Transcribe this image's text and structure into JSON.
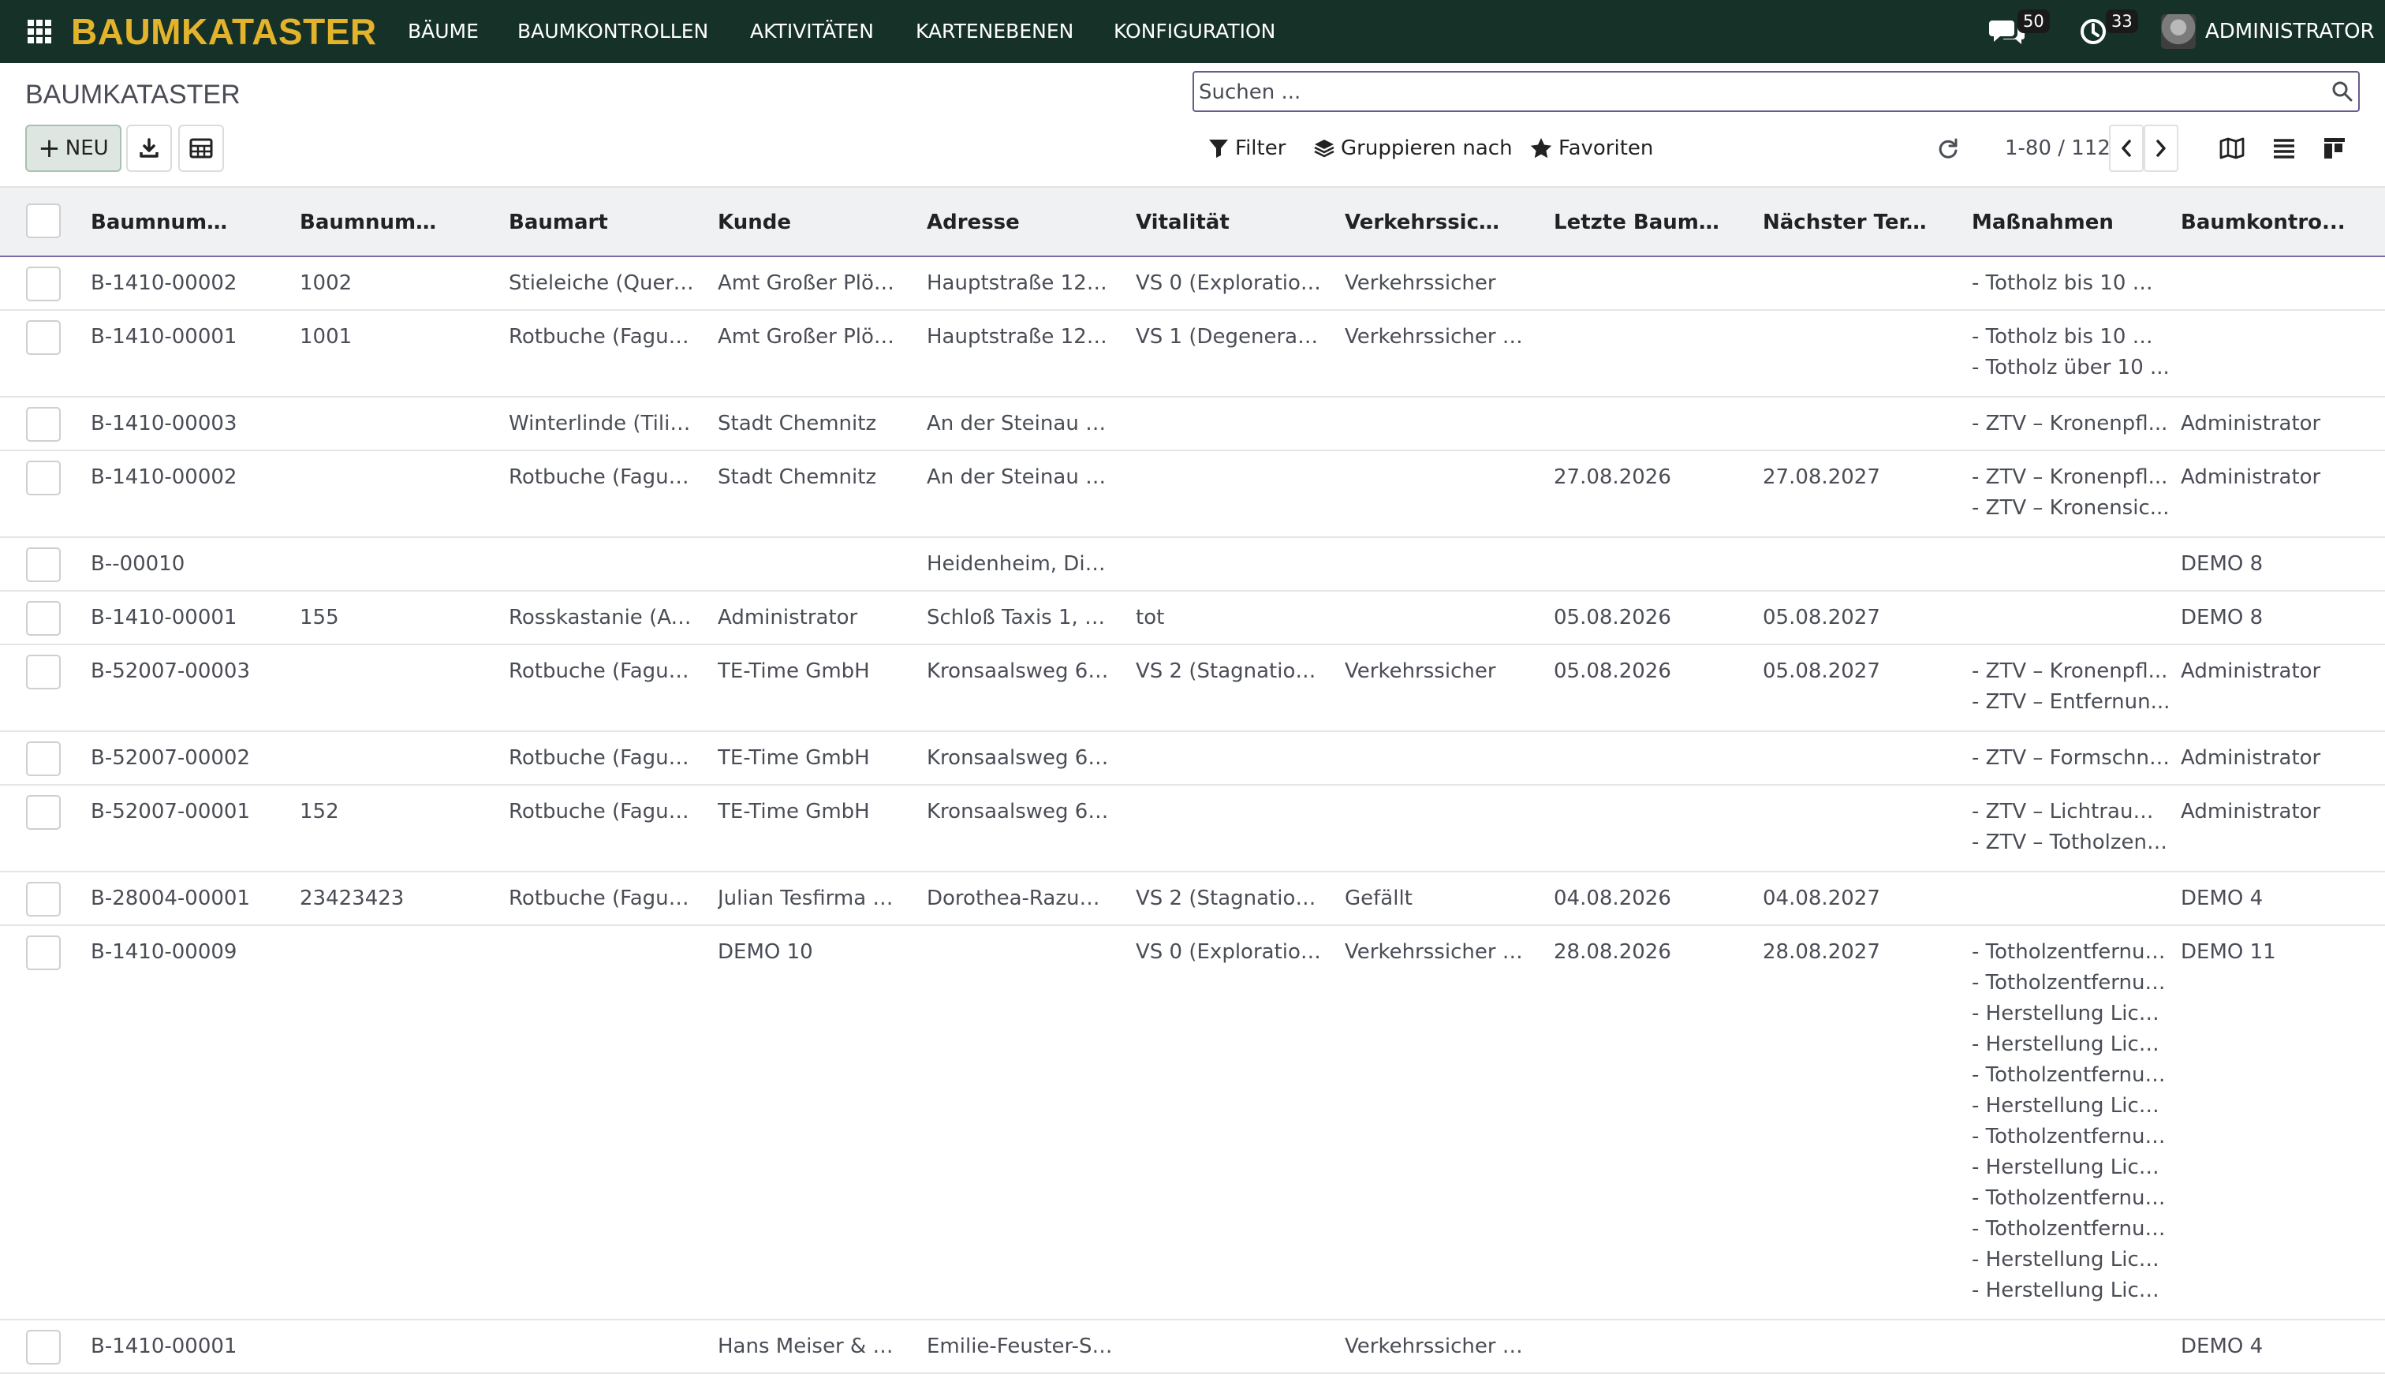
{
  "navbar": {
    "brand": "BAUMKATASTER",
    "menu": [
      "BÄUME",
      "BAUMKONTROLLEN",
      "AKTIVITÄTEN",
      "KARTENEBENEN",
      "KONFIGURATION"
    ],
    "messages_count": "50",
    "activities_count": "33",
    "user": "ADMINISTRATOR",
    "colors": {
      "background": "#163127",
      "brand": "#e4b32c"
    }
  },
  "control_panel": {
    "title": "BAUMKATASTER",
    "search_placeholder": "Suchen ...",
    "new_label": "NEU",
    "filter_label": "Filter",
    "group_label": "Gruppieren nach",
    "favorites_label": "Favoriten",
    "pager": "1-80 / 112"
  },
  "table": {
    "columns": [
      "Baumnummer...",
      "Baumnummer...",
      "Baumart",
      "Kunde",
      "Adresse",
      "Vitalität",
      "Verkehrssiche...",
      "Letzte Baumk...",
      "Nächster Ter...",
      "Maßnahmen",
      "Baumkontro..."
    ],
    "rows": [
      {
        "c": [
          "B-1410-00002",
          "1002",
          "Stieleiche (Quercu...",
          "Amt Großer Plöner...",
          "Hauptstraße 12, P...",
          "VS 0 (Explorations...",
          "Verkehrssicher",
          "",
          ""
        ],
        "m": [
          "- Totholz bis 10 m ..."
        ],
        "k": ""
      },
      {
        "c": [
          "B-1410-00001",
          "1001",
          "Rotbuche (Fagus s...",
          "Amt Großer Plöner...",
          "Hauptstraße 12, P...",
          "VS 1 (Degeneratio...",
          "Verkehrssicher na...",
          "",
          ""
        ],
        "m": [
          "- Totholz bis 10 m ...",
          "- Totholz über 10 ..."
        ],
        "k": ""
      },
      {
        "c": [
          "B-1410-00003",
          "",
          "Winterlinde (Tilia c...",
          "Stadt Chemnitz",
          "An der Steinau 34,...",
          "",
          "",
          "",
          ""
        ],
        "m": [
          "- ZTV – Kronenpfl..."
        ],
        "k": "Administrator"
      },
      {
        "c": [
          "B-1410-00002",
          "",
          "Rotbuche (Fagus s...",
          "Stadt Chemnitz",
          "An der Steinau 34,...",
          "",
          "",
          "27.08.2026",
          "27.08.2027"
        ],
        "m": [
          "- ZTV – Kronenpfl...",
          "- ZTV – Kronensic..."
        ],
        "k": "Administrator"
      },
      {
        "c": [
          "B--00010",
          "",
          "",
          "",
          "Heidenheim, Disch...",
          "",
          "",
          "",
          ""
        ],
        "m": [],
        "k": "DEMO 8"
      },
      {
        "c": [
          "B-1410-00001",
          "155",
          "Rosskastanie (Aes...",
          "Administrator",
          "Schloß Taxis 1, He...",
          "tot",
          "",
          "05.08.2026",
          "05.08.2027"
        ],
        "m": [],
        "k": "DEMO 8"
      },
      {
        "c": [
          "B-52007-00003",
          "",
          "Rotbuche (Fagus s...",
          "TE-Time GmbH",
          "Kronsaalsweg 66, ...",
          "VS 2 (Stagnations...",
          "Verkehrssicher",
          "05.08.2026",
          "05.08.2027"
        ],
        "m": [
          "- ZTV – Kronenpfl...",
          "- ZTV – Entfernun..."
        ],
        "k": "Administrator"
      },
      {
        "c": [
          "B-52007-00002",
          "",
          "Rotbuche (Fagus s...",
          "TE-Time GmbH",
          "Kronsaalsweg 66, ...",
          "",
          "",
          "",
          ""
        ],
        "m": [
          "- ZTV – Formschnitt"
        ],
        "k": "Administrator"
      },
      {
        "c": [
          "B-52007-00001",
          "152",
          "Rotbuche (Fagus s...",
          "TE-Time GmbH",
          "Kronsaalsweg 66, ...",
          "",
          "",
          "",
          ""
        ],
        "m": [
          "- ZTV – Lichtraum...",
          "- ZTV – Totholzent..."
        ],
        "k": "Administrator"
      },
      {
        "c": [
          "B-28004-00001",
          "23423423",
          "Rotbuche (Fagus s...",
          "Julian Tesfirma G...",
          "Dorothea-Razumo...",
          "VS 2 (Stagnations...",
          "Gefällt",
          "04.08.2026",
          "04.08.2027"
        ],
        "m": [],
        "k": "DEMO 4"
      },
      {
        "c": [
          "B-1410-00009",
          "",
          "",
          "DEMO 10",
          "",
          "VS 0 (Explorations...",
          "Verkehrssicher na...",
          "28.08.2026",
          "28.08.2027"
        ],
        "m": [
          "- Totholzentfernung",
          "- Totholzentfernung",
          "- Herstellung Licht...",
          "- Herstellung Licht...",
          "- Totholzentfernung",
          "- Herstellung Licht...",
          "- Totholzentfernung",
          "- Herstellung Licht...",
          "- Totholzentfernung",
          "- Totholzentfernung",
          "- Herstellung Licht...",
          "- Herstellung Licht..."
        ],
        "k": "DEMO 11"
      },
      {
        "c": [
          "B-1410-00001",
          "",
          "",
          "Hans Meiser & Co....",
          "Emilie-Feuster-Str...",
          "",
          "Verkehrssicher mit...",
          "",
          ""
        ],
        "m": [],
        "k": "DEMO 4"
      }
    ]
  }
}
